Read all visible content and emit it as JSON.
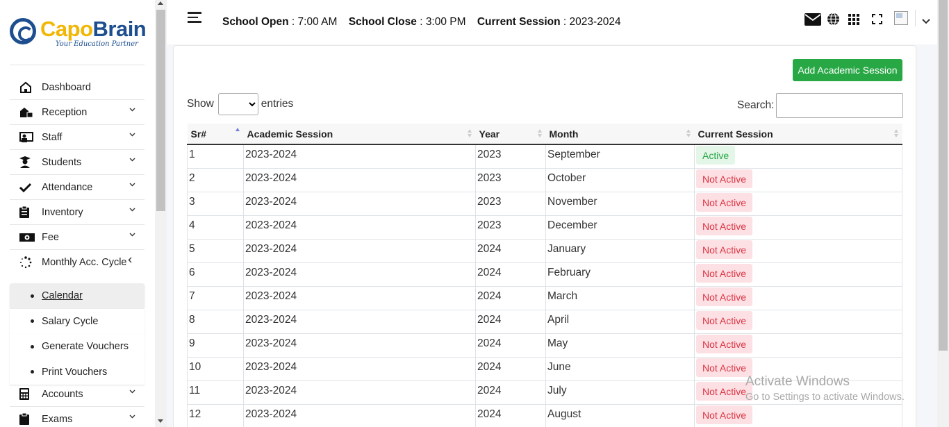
{
  "brand": {
    "name_part1": "Capo",
    "name_part2": "Brain",
    "tagline": "Your Education Partner"
  },
  "sidebar": {
    "items": [
      {
        "label": "Dashboard",
        "icon": "home-icon",
        "expandable": false
      },
      {
        "label": "Reception",
        "icon": "reception-icon",
        "expandable": true
      },
      {
        "label": "Staff",
        "icon": "staff-icon",
        "expandable": true
      },
      {
        "label": "Students",
        "icon": "graduate-icon",
        "expandable": true
      },
      {
        "label": "Attendance",
        "icon": "check-icon",
        "expandable": true
      },
      {
        "label": "Inventory",
        "icon": "clipboard-icon",
        "expandable": true
      },
      {
        "label": "Fee",
        "icon": "money-icon",
        "expandable": true
      },
      {
        "label": "Monthly Acc. Cycle",
        "icon": "spinner-icon",
        "expandable": true,
        "expanded": true
      }
    ],
    "subitems": [
      {
        "label": "Calendar",
        "active": true
      },
      {
        "label": "Salary Cycle"
      },
      {
        "label": "Generate Vouchers"
      },
      {
        "label": "Print Vouchers"
      }
    ],
    "items_after": [
      {
        "label": "Accounts",
        "icon": "calculator-icon"
      },
      {
        "label": "Exams",
        "icon": "clipboard-icon"
      }
    ]
  },
  "header": {
    "open_label": "School Open",
    "open_value": ": 7:00 AM",
    "close_label": "School Close",
    "close_value": ": 3:00 PM",
    "session_label": "Current Session",
    "session_value": ": 2023-2024",
    "icons": [
      "envelope-icon",
      "globe-icon",
      "grid-icon",
      "fullscreen-icon"
    ]
  },
  "main": {
    "add_button": "Add Academic Session",
    "show_label": "Show",
    "entries_label": "entries",
    "search_label": "Search:",
    "columns": [
      "Sr#",
      "Academic Session",
      "Year",
      "Month",
      "Current Session"
    ],
    "rows": [
      {
        "sr": "1",
        "session": "2023-2024",
        "year": "2023",
        "month": "September",
        "status": "Active"
      },
      {
        "sr": "2",
        "session": "2023-2024",
        "year": "2023",
        "month": "October",
        "status": "Not Active"
      },
      {
        "sr": "3",
        "session": "2023-2024",
        "year": "2023",
        "month": "November",
        "status": "Not Active"
      },
      {
        "sr": "4",
        "session": "2023-2024",
        "year": "2023",
        "month": "December",
        "status": "Not Active"
      },
      {
        "sr": "5",
        "session": "2023-2024",
        "year": "2024",
        "month": "January",
        "status": "Not Active"
      },
      {
        "sr": "6",
        "session": "2023-2024",
        "year": "2024",
        "month": "February",
        "status": "Not Active"
      },
      {
        "sr": "7",
        "session": "2023-2024",
        "year": "2024",
        "month": "March",
        "status": "Not Active"
      },
      {
        "sr": "8",
        "session": "2023-2024",
        "year": "2024",
        "month": "April",
        "status": "Not Active"
      },
      {
        "sr": "9",
        "session": "2023-2024",
        "year": "2024",
        "month": "May",
        "status": "Not Active"
      },
      {
        "sr": "10",
        "session": "2023-2024",
        "year": "2024",
        "month": "June",
        "status": "Not Active"
      },
      {
        "sr": "11",
        "session": "2023-2024",
        "year": "2024",
        "month": "July",
        "status": "Not Active"
      },
      {
        "sr": "12",
        "session": "2023-2024",
        "year": "2024",
        "month": "August",
        "status": "Not Active"
      }
    ]
  },
  "watermark": {
    "title": "Activate Windows",
    "subtitle": "Go to Settings to activate Windows."
  },
  "colors": {
    "brand_yellow": "#f2b705",
    "brand_blue": "#1d4e8f",
    "success": "#28a745",
    "danger": "#dc3545"
  }
}
